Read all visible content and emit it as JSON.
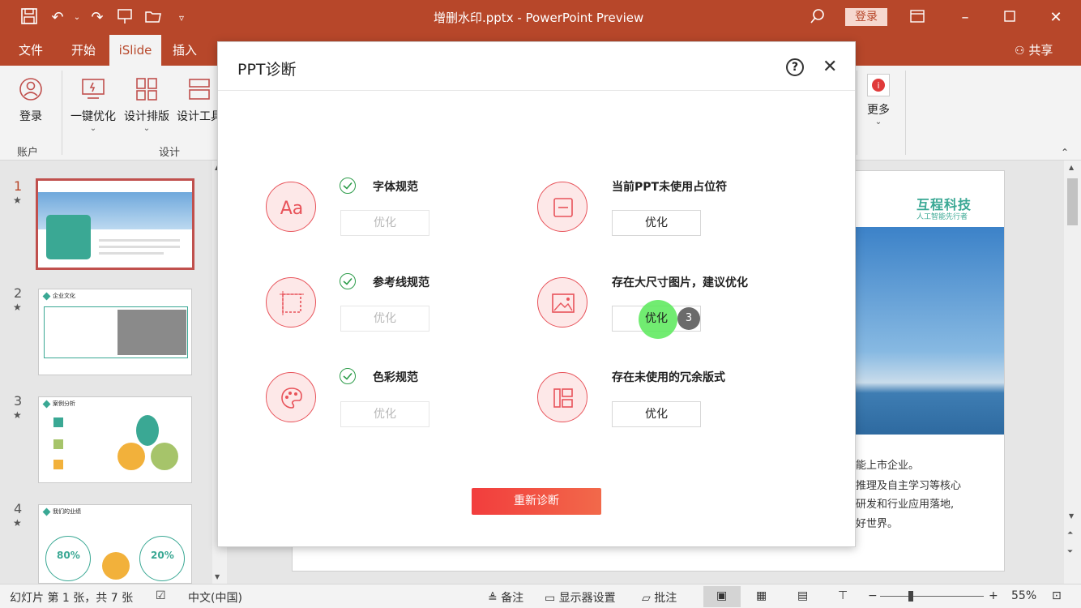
{
  "titlebar": {
    "title": "增删水印.pptx  -  PowerPoint Preview",
    "login": "登录"
  },
  "tabs": [
    "文件",
    "开始",
    "iSlide",
    "插入"
  ],
  "share": "共享",
  "ribbon": {
    "login": "登录",
    "account_group": "账户",
    "one_click": "一键优化",
    "layout": "设计排版",
    "tools": "设计工具",
    "design_group": "设计",
    "more": "更多"
  },
  "slides": [
    {
      "num": "1",
      "star": "★"
    },
    {
      "num": "2",
      "star": "★"
    },
    {
      "num": "3",
      "star": "★"
    },
    {
      "num": "4",
      "star": "★"
    }
  ],
  "thumbs": {
    "s2_title": "企业文化",
    "s3_title": "案例分析",
    "s4_title": "我们的业绩",
    "s4_p1": "80%",
    "s4_p2": "20%"
  },
  "main_slide": {
    "brand": "互程科技",
    "slogan": "人工智能先行者",
    "lines": [
      "能上市企业。",
      "推理及自主学习等核心",
      "研发和行业应用落地,",
      "好世界。"
    ]
  },
  "dialog": {
    "title": "PPT诊断",
    "help": "?",
    "close": "✕",
    "items": [
      {
        "title": "字体规范",
        "button": "优化"
      },
      {
        "title": "参考线规范",
        "button": "优化"
      },
      {
        "title": "色彩规范",
        "button": "优化"
      },
      {
        "title": "当前PPT未使用占位符",
        "button": "优化"
      },
      {
        "title": "存在大尺寸图片，建议优化",
        "button": "优化"
      },
      {
        "title": "存在未使用的冗余版式",
        "button": "优化"
      }
    ],
    "badge": "3",
    "rediagnose": "重新诊断"
  },
  "status": {
    "slide_info": "幻灯片 第 1 张，共 7 张",
    "lang": "中文(中国)",
    "notes": "备注",
    "display": "显示器设置",
    "comments": "批注",
    "zoom": "55%"
  },
  "colors": {
    "brand": "#b7472a",
    "accent_red": "#e8535a",
    "check_green": "#2d9c4a",
    "teal": "#3aa894"
  }
}
